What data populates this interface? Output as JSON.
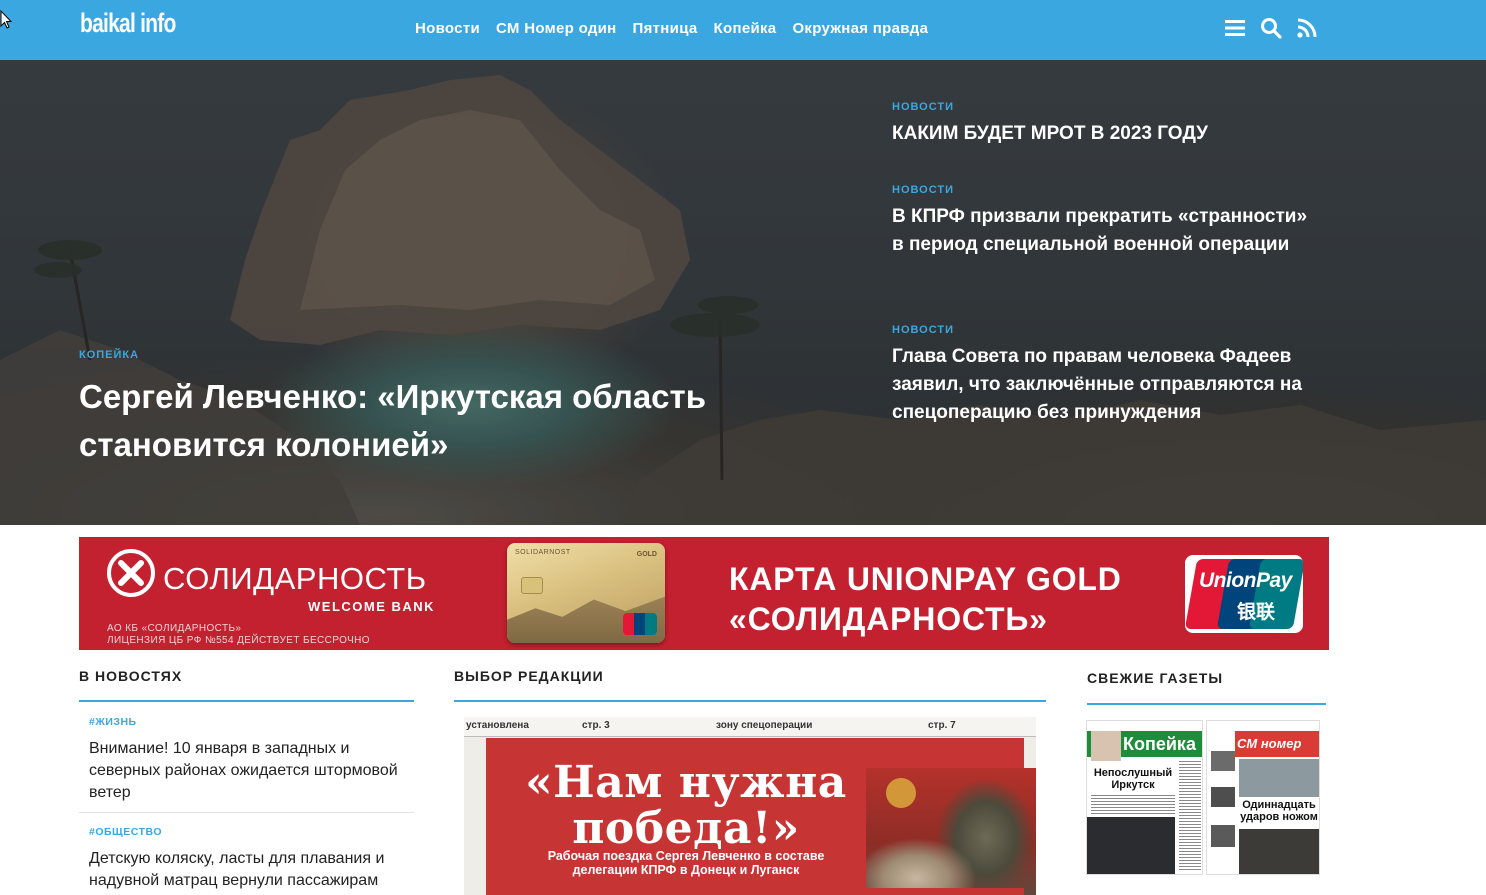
{
  "header": {
    "logo": "baikal info",
    "nav": [
      "Новости",
      "СМ Номер один",
      "Пятница",
      "Копейка",
      "Окружная правда"
    ],
    "icons": [
      "menu-icon",
      "search-icon",
      "rss-icon"
    ],
    "accent": "#3aa7e0"
  },
  "hero": {
    "main": {
      "category": "КОПЕЙКА",
      "title": "Сергей Левченко: «Иркутская область становится колонией»"
    },
    "side": [
      {
        "category": "НОВОСТИ",
        "title": "КАКИМ БУДЕТ МРОТ В 2023 ГОДУ"
      },
      {
        "category": "НОВОСТИ",
        "title": "В КПРФ призвали прекратить «странности» в период специальной военной операции"
      },
      {
        "category": "НОВОСТИ",
        "title": "Глава Совета по правам человека Фадеев заявил, что заключённые отправляются на спецоперацию без принуждения"
      }
    ]
  },
  "banner": {
    "bank_name": "СОЛИДАРНОСТЬ",
    "welcome": "WELCOME BANK",
    "legal_1": "АО КБ «СОЛИДАРНОСТЬ»",
    "legal_2": "ЛИЦЕНЗИЯ ЦБ РФ №554 ДЕЙСТВУЕТ БЕССРОЧНО",
    "card_brand": "SOLIDARNOST",
    "card_gold": "GOLD",
    "title_1": "КАРТА UNIONPAY GOLD",
    "title_2": "«СОЛИДАРНОСТЬ»",
    "unionpay_latin": "UnionPay",
    "unionpay_cn": "银联",
    "color": "#c32030"
  },
  "columns": {
    "news_heading": "В НОВОСТЯХ",
    "editor_heading": "ВЫБОР РЕДАКЦИИ",
    "papers_heading": "СВЕЖИЕ ГАЗЕТЫ"
  },
  "news": [
    {
      "tag": "#ЖИЗНЬ",
      "text": "Внимание! 10 января в западных и северных районах ожидается штормовой ветер"
    },
    {
      "tag": "#ОБЩЕСТВО",
      "text": "Детскую коляску, ласты для плавания и надувной матрац вернули пассажирам"
    }
  ],
  "editor_pick": {
    "strip_left": "установлена",
    "strip_page_a": "стр. 3",
    "strip_mid": "зону спецоперации",
    "strip_page_b": "стр. 7",
    "headline": "«Нам нужна победа!»",
    "subhead": "Рабочая поездка Сергея Левченко в составе делегации КПРФ в Донецк и Луганск"
  },
  "papers": [
    {
      "masthead": "Копейка",
      "headline": "Непослушный Иркутск"
    },
    {
      "masthead": "СМ номер один",
      "headline": "Одиннадцать ударов ножом"
    }
  ]
}
